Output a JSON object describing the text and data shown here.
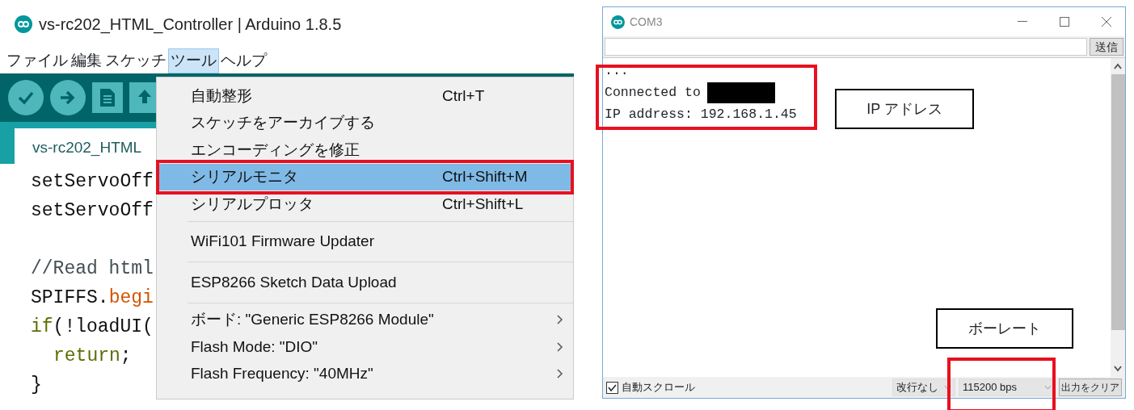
{
  "editor": {
    "title": "vs-rc202_HTML_Controller | Arduino 1.8.5",
    "menubar": [
      {
        "label": "ファイル",
        "selected": false
      },
      {
        "label": "編集",
        "selected": false
      },
      {
        "label": "スケッチ",
        "selected": false
      },
      {
        "label": "ツール",
        "selected": true
      },
      {
        "label": "ヘルプ",
        "selected": false
      }
    ],
    "tab": "vs-rc202_HTML",
    "code_lines": [
      {
        "tokens": [
          {
            "kind": "plain",
            "text": "setServoOff"
          }
        ]
      },
      {
        "tokens": [
          {
            "kind": "plain",
            "text": "setServoOff"
          }
        ]
      },
      {
        "blank_before": true,
        "tokens": [
          {
            "kind": "comment",
            "text": "//Read html"
          }
        ]
      },
      {
        "tokens": [
          {
            "kind": "plain",
            "text": "SPIFFS."
          },
          {
            "kind": "method",
            "text": "begi"
          }
        ]
      },
      {
        "tokens": [
          {
            "kind": "keyword",
            "text": "if"
          },
          {
            "kind": "plain",
            "text": "(!loadUI("
          }
        ],
        "children": [
          {
            "tokens": [
              {
                "kind": "keyword",
                "text": "return"
              },
              {
                "kind": "plain",
                "text": ";"
              }
            ]
          }
        ]
      },
      {
        "tokens": [
          {
            "kind": "plain",
            "text": "}"
          }
        ]
      }
    ],
    "tools_menu": {
      "groups": [
        [
          {
            "label": "自動整形",
            "shortcut": "Ctrl+T",
            "selected": false
          },
          {
            "label": "スケッチをアーカイブする",
            "selected": false
          },
          {
            "label": "エンコーディングを修正",
            "selected": false
          },
          {
            "label": "シリアルモニタ",
            "shortcut": "Ctrl+Shift+M",
            "selected": true
          },
          {
            "label": "シリアルプロッタ",
            "shortcut": "Ctrl+Shift+L",
            "selected": false
          }
        ],
        [
          {
            "label": "WiFi101 Firmware Updater",
            "selected": false
          }
        ],
        [
          {
            "label": "ESP8266 Sketch Data Upload",
            "selected": false
          }
        ],
        [
          {
            "label": "ボード: \"Generic ESP8266 Module\"",
            "submenu": true,
            "selected": false
          },
          {
            "label": "Flash Mode: \"DIO\"",
            "submenu": true,
            "selected": false
          },
          {
            "label": "Flash Frequency: \"40MHz\"",
            "submenu": true,
            "selected": false
          }
        ]
      ]
    }
  },
  "serial_monitor": {
    "title": "COM3",
    "send_button": "送信",
    "output_lines": [
      {
        "text": "..."
      },
      {
        "text": "Connected to",
        "redacted": true
      },
      {
        "text": "IP address: 192.168.1.45"
      }
    ],
    "autoscroll": {
      "label": "自動スクロール",
      "checked": true
    },
    "line_ending": "改行なし",
    "baud_rate": "115200 bps",
    "clear_button": "出力をクリア"
  },
  "annotations": [
    {
      "text": "IP アドレス"
    },
    {
      "text": "ボーレート"
    }
  ]
}
